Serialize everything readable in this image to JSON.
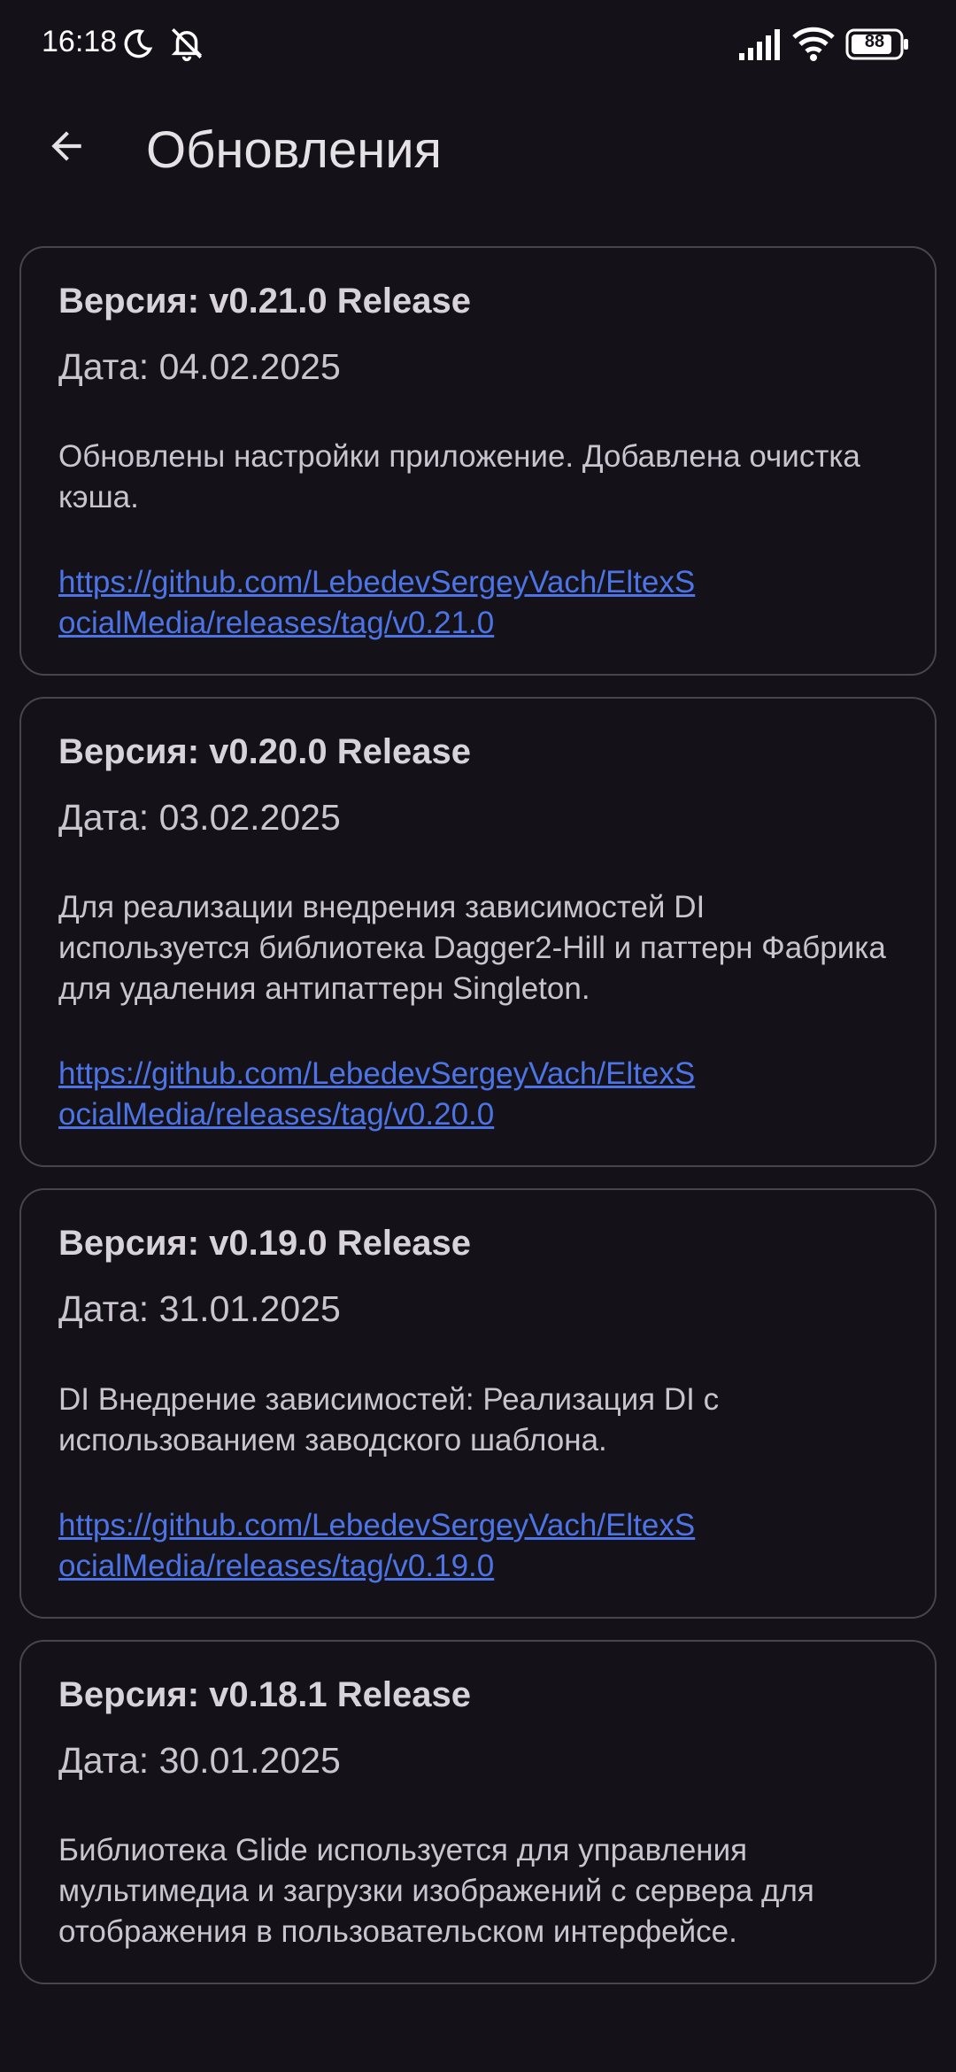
{
  "status_bar": {
    "time": "16:18",
    "battery": "88",
    "icons": [
      "moon-icon",
      "silent-bell-icon",
      "signal-icon",
      "wifi-icon",
      "battery-icon"
    ]
  },
  "app_bar": {
    "title": "Обновления",
    "back_icon": "arrow-back-icon"
  },
  "colors": {
    "background": "#141218",
    "card_border": "#48454e",
    "link": "#4c74e6",
    "text": "#cac4cf"
  },
  "releases": [
    {
      "version": "Версия: v0.21.0 Release",
      "date": "Дата: 04.02.2025",
      "description": "Обновлены настройки приложение. Добавлена очистка кэша.",
      "link": "https://github.com/LebedevSergeyVach/EltexSocialMedia/releases/tag/v0.21.0"
    },
    {
      "version": "Версия: v0.20.0 Release",
      "date": "Дата: 03.02.2025",
      "description": "Для реализации внедрения зависимостей DI используется библиотека Dagger2-Hill и паттерн Фабрика для удаления антипаттерн Singleton.",
      "link": "https://github.com/LebedevSergeyVach/EltexSocialMedia/releases/tag/v0.20.0"
    },
    {
      "version": "Версия: v0.19.0 Release",
      "date": "Дата: 31.01.2025",
      "description": "DI Внедрение зависимостей: Реализация DI с использованием заводского шаблона.",
      "link": "https://github.com/LebedevSergeyVach/EltexSocialMedia/releases/tag/v0.19.0"
    },
    {
      "version": "Версия: v0.18.1 Release",
      "date": "Дата: 30.01.2025",
      "description": "Библиотека Glide используется для управления мультимедиа и загрузки изображений с сервера для отображения в пользовательском интерфейсе.",
      "link": ""
    }
  ]
}
